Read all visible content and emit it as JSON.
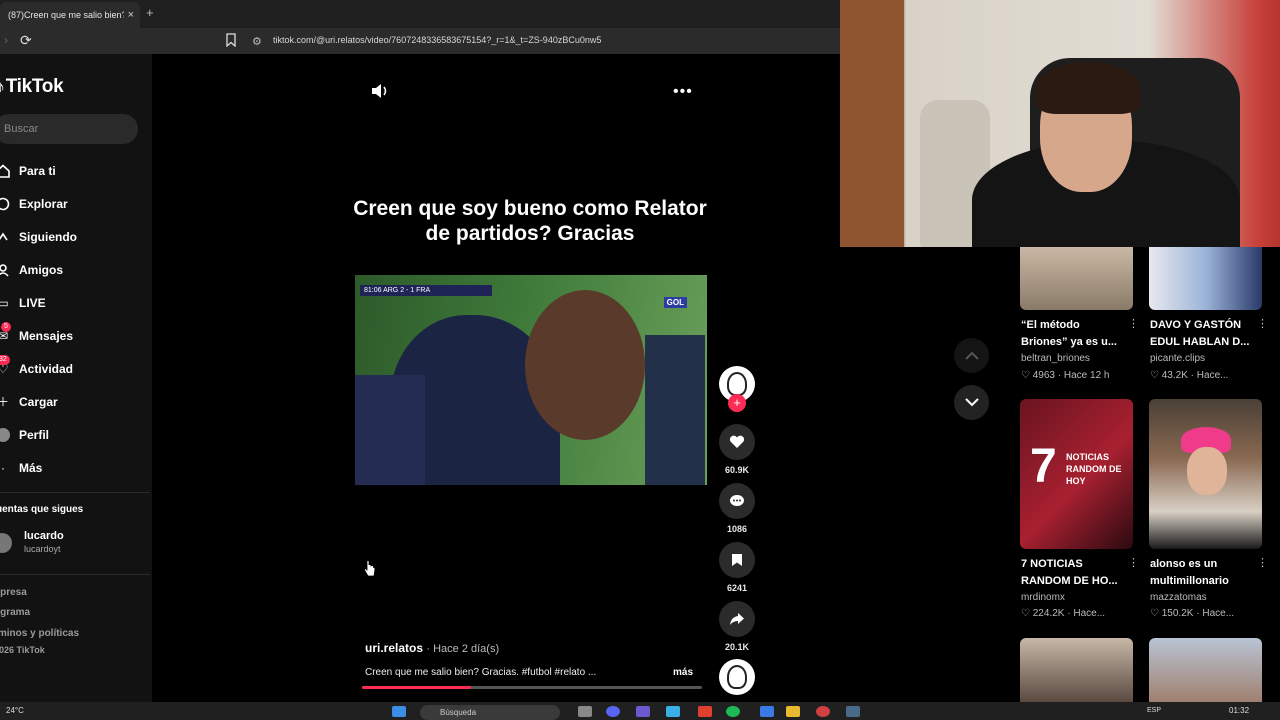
{
  "browser": {
    "tab_title": "(87)Creen que me salio bien?",
    "tab_close": "×",
    "new_tab": "+",
    "url": "tiktok.com/@uri.relatos/video/7607248336583675154?_r=1&_t=ZS-940zBCu0nw5"
  },
  "sidebar": {
    "logo": "TikTok",
    "search_placeholder": "Buscar",
    "items": [
      {
        "label": "Para ti",
        "icon": "home-icon"
      },
      {
        "label": "Explorar",
        "icon": "compass-icon"
      },
      {
        "label": "Siguiendo",
        "icon": "following-icon"
      },
      {
        "label": "Amigos",
        "icon": "friends-icon"
      },
      {
        "label": "LIVE",
        "icon": "live-icon"
      },
      {
        "label": "Mensajes",
        "icon": "messages-icon",
        "badge": "5"
      },
      {
        "label": "Actividad",
        "icon": "activity-icon",
        "badge": "32"
      },
      {
        "label": "Cargar",
        "icon": "upload-icon"
      },
      {
        "label": "Perfil",
        "icon": "profile-icon"
      },
      {
        "label": "Más",
        "icon": "more-icon"
      }
    ],
    "following_header": "uentas que sigues",
    "account": {
      "name": "lucardo",
      "handle": "lucardoyt"
    },
    "footer": [
      "npresa",
      "ograma",
      "rminos y políticas",
      "2026 TikTok"
    ]
  },
  "video": {
    "caption": "Creen que soy bueno como Relator de partidos? Gracias",
    "scoreboard": "81:06  ARG 2 - 1 FRA",
    "channel_logo": "GOL",
    "likes": "60.9K",
    "comments": "1086",
    "saves": "6241",
    "shares": "20.1K",
    "author": "uri.relatos",
    "posted": "· Hace 2 día(s)",
    "description": "Creen que me salio bien? Gracias. #futbol #relato ...",
    "more_label": "más",
    "progress": 0.32
  },
  "feed": [
    {
      "title": "“El método Briones” ya es u...",
      "author": "beltran_briones",
      "likes": "4963",
      "age": "· Hace 12 h"
    },
    {
      "title": "DAVO Y GASTÓN EDUL HABLAN D...",
      "author": "picante.clips",
      "likes": "43.2K",
      "age": "· Hace..."
    },
    {
      "title": "7 NOTICIAS RANDOM DE HO...",
      "author": "mrdinomx",
      "likes": "224.2K",
      "age": "· Hace...",
      "thumb_num": "7",
      "thumb_text": "NOTICIAS RANDOM DE HOY"
    },
    {
      "title": "alonso es un multimillonario",
      "author": "mazzatomas",
      "likes": "150.2K",
      "age": "· Hace..."
    }
  ],
  "taskbar": {
    "temperature": "24°C",
    "search": "Búsqueda",
    "language": "ESP",
    "time": "01:32"
  },
  "colors": {
    "accent": "#fe2c55",
    "background": "#000000",
    "sidebar": "#121212"
  }
}
